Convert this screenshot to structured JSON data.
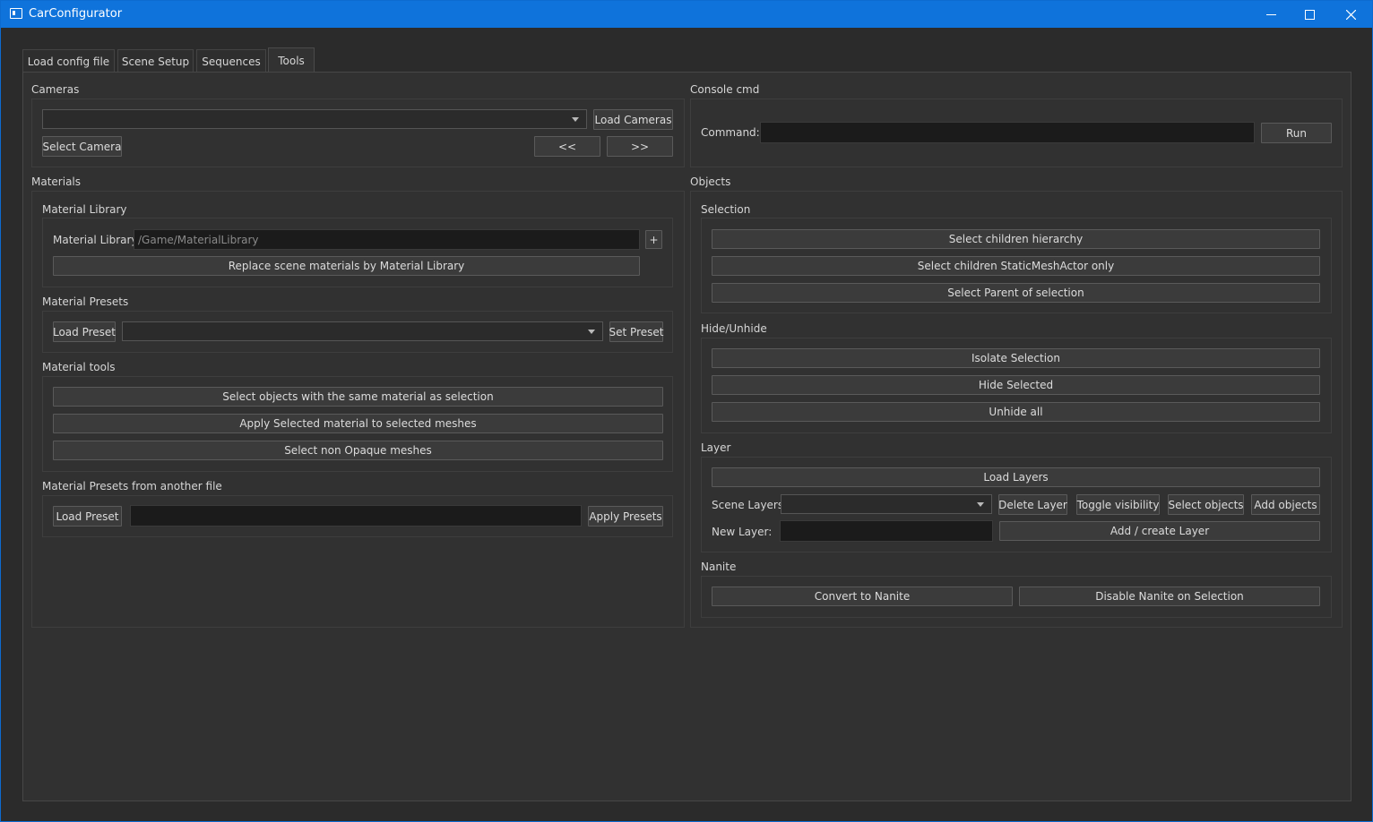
{
  "window": {
    "title": "CarConfigurator"
  },
  "tabs": [
    "Load config file",
    "Scene Setup",
    "Sequences",
    "Tools"
  ],
  "active_tab": "Tools",
  "cameras": {
    "title": "Cameras",
    "load_cameras": "Load Cameras",
    "select_camera": "Select Camera",
    "prev": "<<",
    "next": ">>"
  },
  "console": {
    "title": "Console cmd",
    "command_label": "Command:",
    "run": "Run"
  },
  "materials": {
    "title": "Materials",
    "library": {
      "title": "Material Library",
      "label": "Material Library:",
      "path_value": "/Game/MaterialLibrary",
      "plus": "+",
      "replace": "Replace scene materials by Material Library"
    },
    "presets": {
      "title": "Material Presets",
      "load": "Load Preset",
      "set": "Set Preset"
    },
    "tools": {
      "title": "Material tools",
      "select_same": "Select objects with the same material as selection",
      "apply_selected": "Apply Selected material to selected meshes",
      "select_non_opaque": "Select non Opaque meshes"
    },
    "presets_file": {
      "title": "Material Presets from another file",
      "load": "Load Preset",
      "apply": "Apply Presets"
    }
  },
  "objects": {
    "title": "Objects",
    "selection": {
      "title": "Selection",
      "children_hierarchy": "Select children hierarchy",
      "children_static": "Select children StaticMeshActor only",
      "parent": "Select Parent of selection"
    },
    "hide": {
      "title": "Hide/Unhide",
      "isolate": "Isolate Selection",
      "hide_selected": "Hide Selected",
      "unhide_all": "Unhide all"
    },
    "layer": {
      "title": "Layer",
      "load_layers": "Load Layers",
      "scene_layers_label": "Scene Layers:",
      "delete": "Delete Layer",
      "toggle": "Toggle visibility",
      "select_objects": "Select objects",
      "add_objects": "Add objects",
      "new_layer_label": "New Layer:",
      "add_create": "Add / create Layer"
    },
    "nanite": {
      "title": "Nanite",
      "convert": "Convert to Nanite",
      "disable": "Disable Nanite on Selection"
    }
  },
  "colors": {
    "titlebar": "#0f73db",
    "background": "#313131",
    "button": "#3b3b3b",
    "input": "#1b1b1b"
  }
}
